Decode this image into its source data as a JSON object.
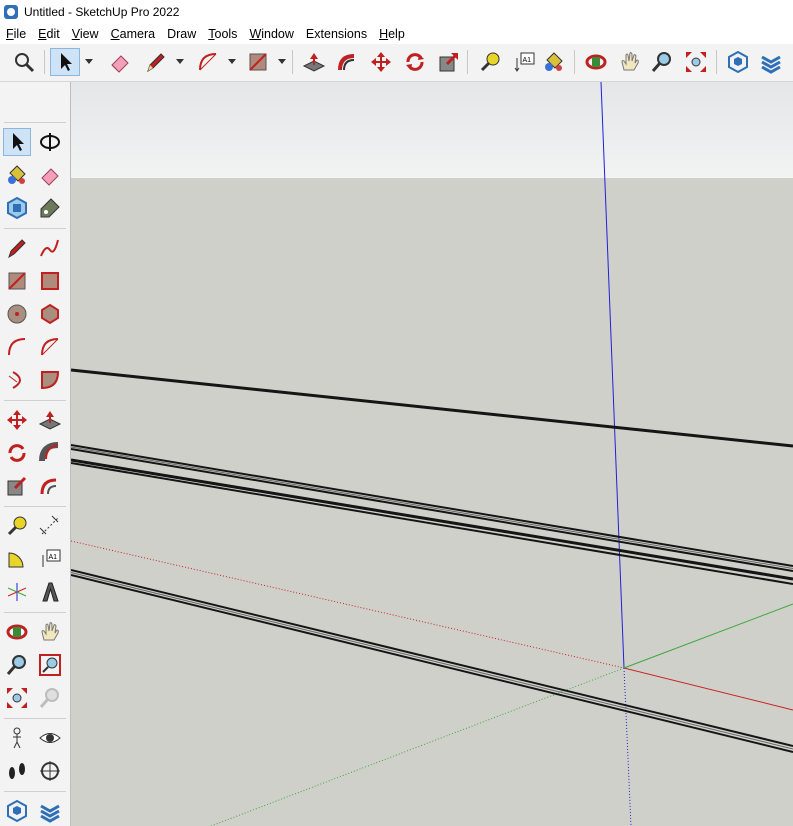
{
  "window": {
    "title": "Untitled - SketchUp Pro 2022"
  },
  "menu": {
    "items": [
      {
        "key": "F",
        "rest": "ile"
      },
      {
        "key": "E",
        "rest": "dit"
      },
      {
        "key": "V",
        "rest": "iew"
      },
      {
        "key": "C",
        "rest": "amera"
      },
      {
        "key": "D",
        "rest": "raw"
      },
      {
        "key": "T",
        "rest": "ools"
      },
      {
        "key": "W",
        "rest": "indow"
      },
      {
        "key": "E",
        "rest": "xtensions"
      },
      {
        "key": "H",
        "rest": "elp"
      }
    ]
  },
  "toolbar": {
    "icons": [
      "search-zoom-icon",
      "select-arrow-icon",
      "eraser-icon",
      "pencil-line-icon",
      "arc-icon",
      "rectangle-icon",
      "push-pull-icon",
      "follow-me-icon",
      "move-icon",
      "rotate-icon",
      "scale-icon",
      "tape-measure-icon",
      "text-label-icon",
      "paint-bucket-icon",
      "orbit-icon",
      "pan-hand-icon",
      "zoom-magnifier-icon",
      "zoom-extents-icon",
      "extension-warehouse-icon",
      "sandbox-icon"
    ],
    "text_icon_label": "A1"
  },
  "leftbar": {
    "icons": [
      "select-icon",
      "orbit-icon",
      "paint-bucket-icon",
      "eraser-icon",
      "component-icon",
      "tag-icon",
      "pencil-line-icon",
      "freehand-icon",
      "rectangle-icon",
      "rotated-rectangle-icon",
      "circle-icon",
      "polygon-icon",
      "arc-icon",
      "two-point-arc-icon",
      "three-point-arc-icon",
      "pie-icon",
      "move-icon",
      "push-pull-icon",
      "rotate-icon",
      "follow-me-icon",
      "scale-icon",
      "offset-icon",
      "tape-measure-icon",
      "dimension-icon",
      "protractor-icon",
      "text-icon",
      "axes-icon",
      "3d-text-icon",
      "orbit-3d-icon",
      "pan-icon",
      "zoom-icon",
      "zoom-window-icon",
      "zoom-extents-icon",
      "previous-view-icon",
      "position-camera-icon",
      "look-around-icon",
      "walk-icon",
      "section-plane-icon",
      "warehouse-icon",
      "sandbox-icon"
    ],
    "text_icon_label": "A1"
  },
  "colors": {
    "sky_top": "#e9eaeb",
    "ground": "#d0d0cb",
    "axis_blue": "#2020d8",
    "axis_red": "#cc2020",
    "axis_green": "#3aa83a",
    "edge": "#151515"
  }
}
